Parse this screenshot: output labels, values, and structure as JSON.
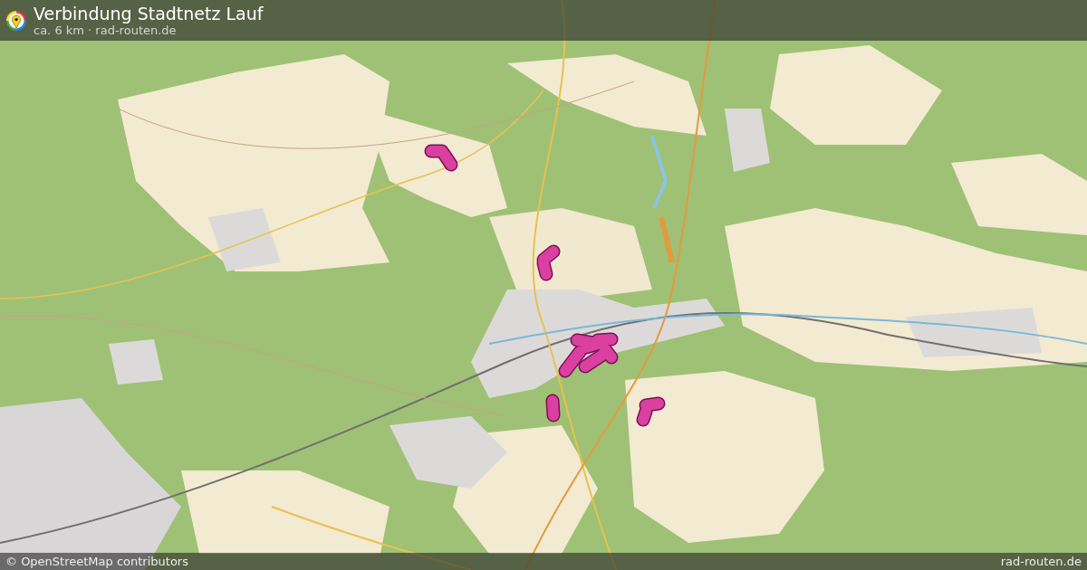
{
  "header": {
    "title": "Verbindung Stadtnetz Lauf",
    "subtitle": "ca. 6 km · rad-routen.de"
  },
  "footer": {
    "attribution": "© OpenStreetMap contributors",
    "site": "rad-routen.de"
  }
}
